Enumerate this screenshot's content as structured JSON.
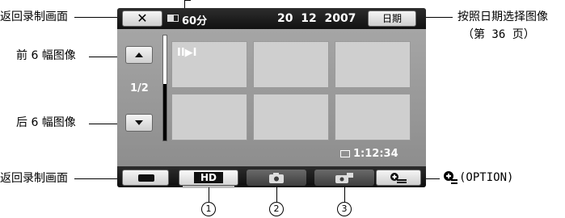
{
  "callouts": {
    "back_to_record_top": "返回录制画面",
    "prev_six": "前 6 幅图像",
    "next_six": "后 6 幅图像",
    "back_to_record_bottom": "返回录制画面",
    "select_by_date_line1": "按照日期选择图像",
    "select_by_date_line2": "（第 36 页）",
    "option_label": "(OPTION)"
  },
  "screen": {
    "battery": "60分",
    "date": "20  12  2007",
    "date_button": "日期",
    "page_indicator": "1/2",
    "play_marker": "II▶I",
    "counter": "1:12:34",
    "close_symbol": "✕"
  },
  "tabs": {
    "hd_label": "HD"
  },
  "numbers": [
    "1",
    "2",
    "3"
  ]
}
